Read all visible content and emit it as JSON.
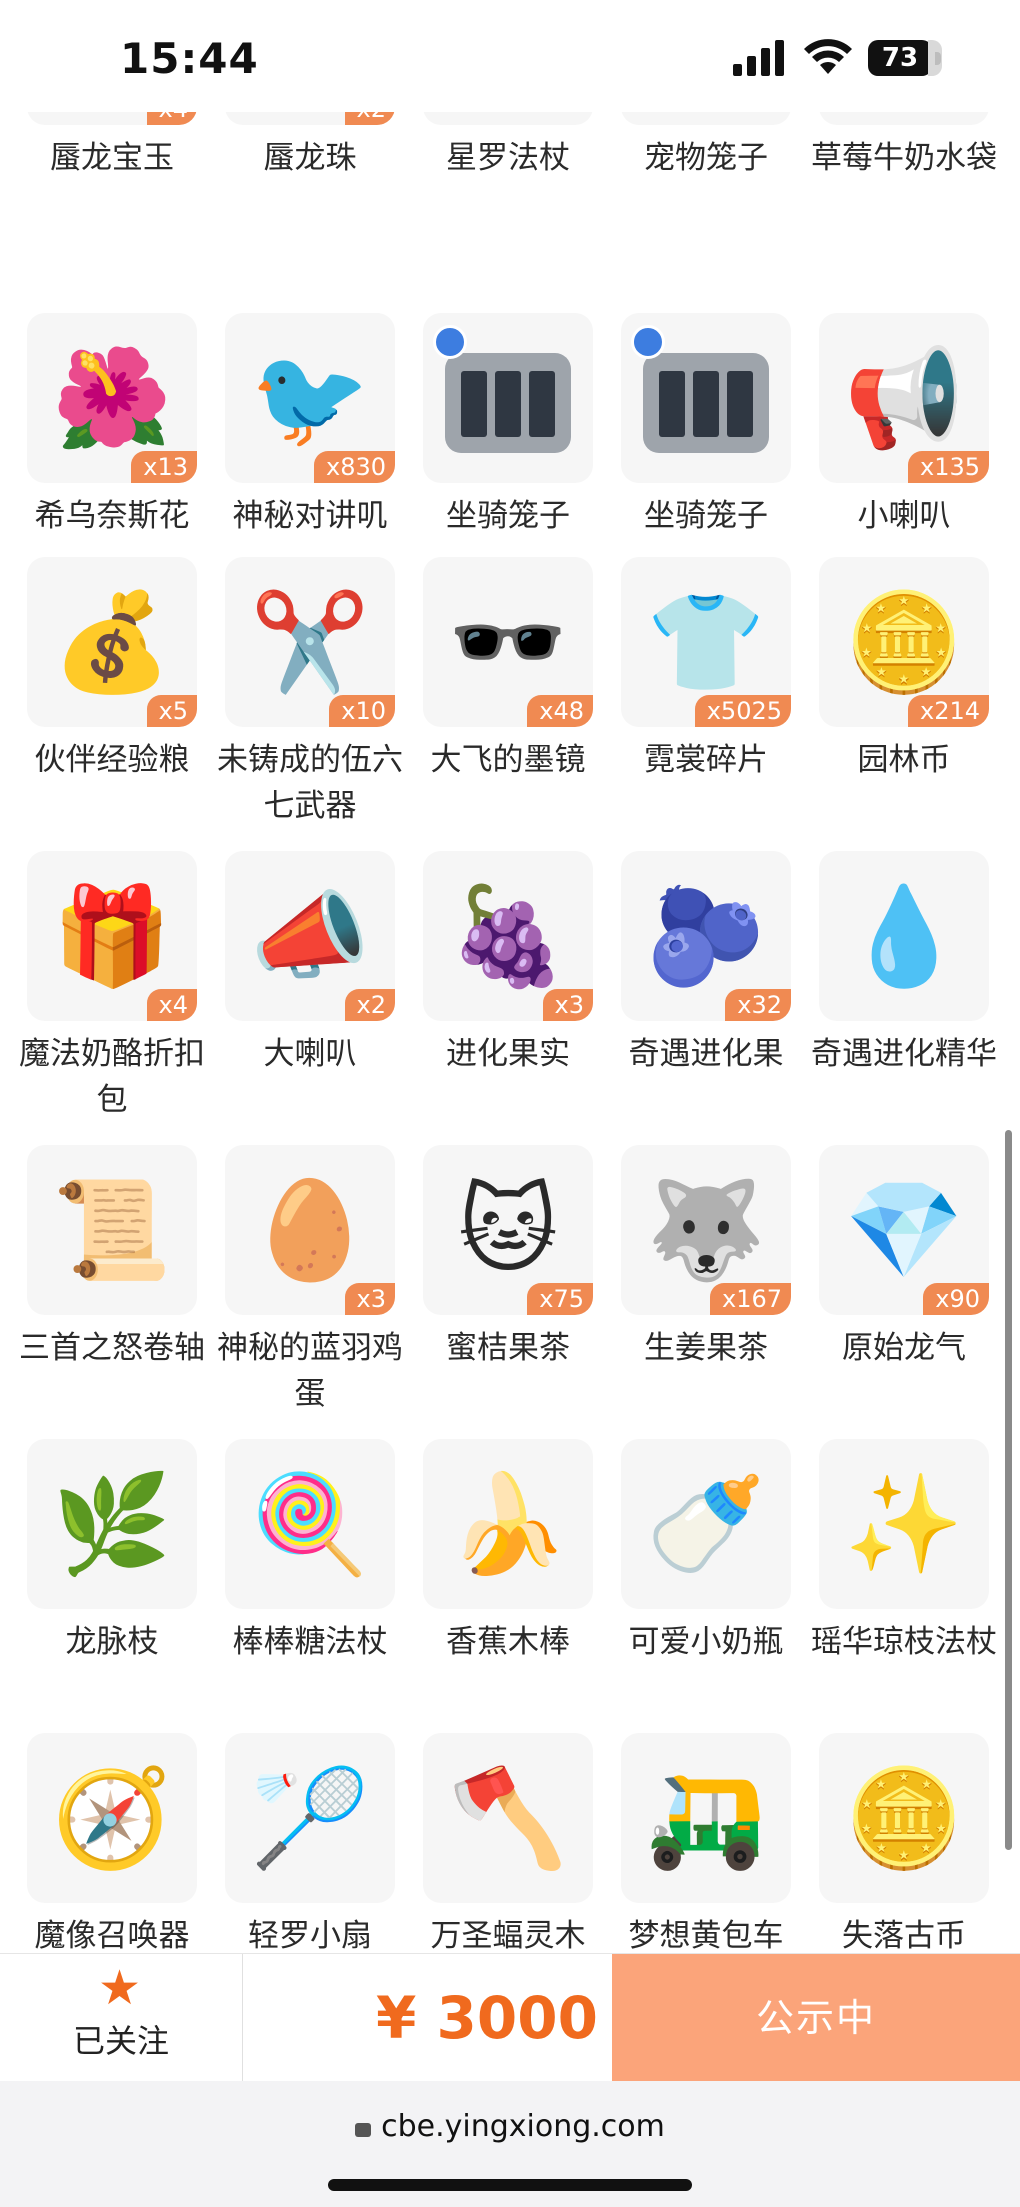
{
  "status_bar": {
    "time": "15:44",
    "battery": "73"
  },
  "items": [
    {
      "name": "蜃龙宝玉",
      "qty": "x4",
      "icon": "purple-orb-icon",
      "glyph": "🔮"
    },
    {
      "name": "蜃龙珠",
      "qty": "x2",
      "icon": "purple-pearl-icon",
      "glyph": "🟣"
    },
    {
      "name": "星罗法杖",
      "qty": "",
      "icon": "wand-icon",
      "glyph": "🪄"
    },
    {
      "name": "宠物笼子",
      "qty": "",
      "icon": "pet-cage-icon",
      "glyph": "cage"
    },
    {
      "name": "草莓牛奶水袋",
      "qty": "",
      "icon": "strawberry-milk-icon",
      "glyph": "🍓"
    },
    {
      "name": "希乌奈斯花",
      "qty": "x13",
      "icon": "red-flower-icon",
      "glyph": "🌺"
    },
    {
      "name": "神秘对讲叽",
      "qty": "x830",
      "icon": "walkie-talkie-bird-icon",
      "glyph": "🐦"
    },
    {
      "name": "坐骑笼子",
      "qty": "",
      "icon": "mount-cage-icon",
      "glyph": "cage-tag"
    },
    {
      "name": "坐骑笼子",
      "qty": "",
      "icon": "mount-cage-icon",
      "glyph": "cage-tag"
    },
    {
      "name": "小喇叭",
      "qty": "x135",
      "icon": "megaphone-icon",
      "glyph": "📢"
    },
    {
      "name": "伙伴经验粮",
      "qty": "x5",
      "icon": "food-bag-icon",
      "glyph": "💰"
    },
    {
      "name": "未铸成的伍六七武器",
      "qty": "x10",
      "icon": "scissors-icon",
      "glyph": "✂️"
    },
    {
      "name": "大飞的墨镜",
      "qty": "x48",
      "icon": "sunglasses-icon",
      "glyph": "🕶️"
    },
    {
      "name": "霓裳碎片",
      "qty": "x5025",
      "icon": "shirt-icon",
      "glyph": "👕"
    },
    {
      "name": "园林币",
      "qty": "x214",
      "icon": "gold-coin-icon",
      "glyph": "🪙"
    },
    {
      "name": "魔法奶酪折扣包",
      "qty": "x4",
      "icon": "gift-box-icon",
      "glyph": "🎁"
    },
    {
      "name": "大喇叭",
      "qty": "x2",
      "icon": "big-megaphone-icon",
      "glyph": "📣"
    },
    {
      "name": "进化果实",
      "qty": "x3",
      "icon": "raspberry-icon",
      "glyph": "🍇"
    },
    {
      "name": "奇遇进化果",
      "qty": "x32",
      "icon": "blue-fruit-icon",
      "glyph": "🫐"
    },
    {
      "name": "奇遇进化精华",
      "qty": "",
      "icon": "blue-essence-icon",
      "glyph": "💧"
    },
    {
      "name": "三首之怒卷轴",
      "qty": "",
      "icon": "scroll-icon",
      "glyph": "📜"
    },
    {
      "name": "神秘的蓝羽鸡蛋",
      "qty": "x3",
      "icon": "blue-egg-icon",
      "glyph": "🥚"
    },
    {
      "name": "蜜桔果茶",
      "qty": "x75",
      "icon": "orange-cat-box-icon",
      "glyph": "🐱"
    },
    {
      "name": "生姜果茶",
      "qty": "x167",
      "icon": "grey-cat-box-icon",
      "glyph": "🐺"
    },
    {
      "name": "原始龙气",
      "qty": "x90",
      "icon": "green-crystal-icon",
      "glyph": "💎"
    },
    {
      "name": "龙脉枝",
      "qty": "",
      "icon": "branch-staff-icon",
      "glyph": "🌿"
    },
    {
      "name": "棒棒糖法杖",
      "qty": "",
      "icon": "lollipop-icon",
      "glyph": "🍭"
    },
    {
      "name": "香蕉木棒",
      "qty": "",
      "icon": "banana-icon",
      "glyph": "🍌"
    },
    {
      "name": "可爱小奶瓶",
      "qty": "",
      "icon": "baby-bottle-icon",
      "glyph": "🍼"
    },
    {
      "name": "瑶华琼枝法杖",
      "qty": "",
      "icon": "ornate-staff-icon",
      "glyph": "✨"
    },
    {
      "name": "魔像召唤器",
      "qty": "",
      "icon": "summoner-icon",
      "glyph": "🧭"
    },
    {
      "name": "轻罗小扇",
      "qty": "",
      "icon": "fan-icon",
      "glyph": "🏸"
    },
    {
      "name": "万圣蝠灵木",
      "qty": "",
      "icon": "spider-axe-icon",
      "glyph": "🪓"
    },
    {
      "name": "梦想黄包车",
      "qty": "",
      "icon": "rickshaw-icon",
      "glyph": "🛺"
    },
    {
      "name": "失落古币",
      "qty": "",
      "icon": "ancient-coin-icon",
      "glyph": "🪙"
    }
  ],
  "bottom_bar": {
    "follow_label": "已关注",
    "price": "¥ 3000",
    "action_label": "公示中"
  },
  "browser": {
    "url": "cbe.yingxiong.com"
  },
  "colors": {
    "accent": "#f06a1e",
    "badge": "#f08a52",
    "cta": "#fba47a",
    "tile": "#f6f6f6"
  }
}
